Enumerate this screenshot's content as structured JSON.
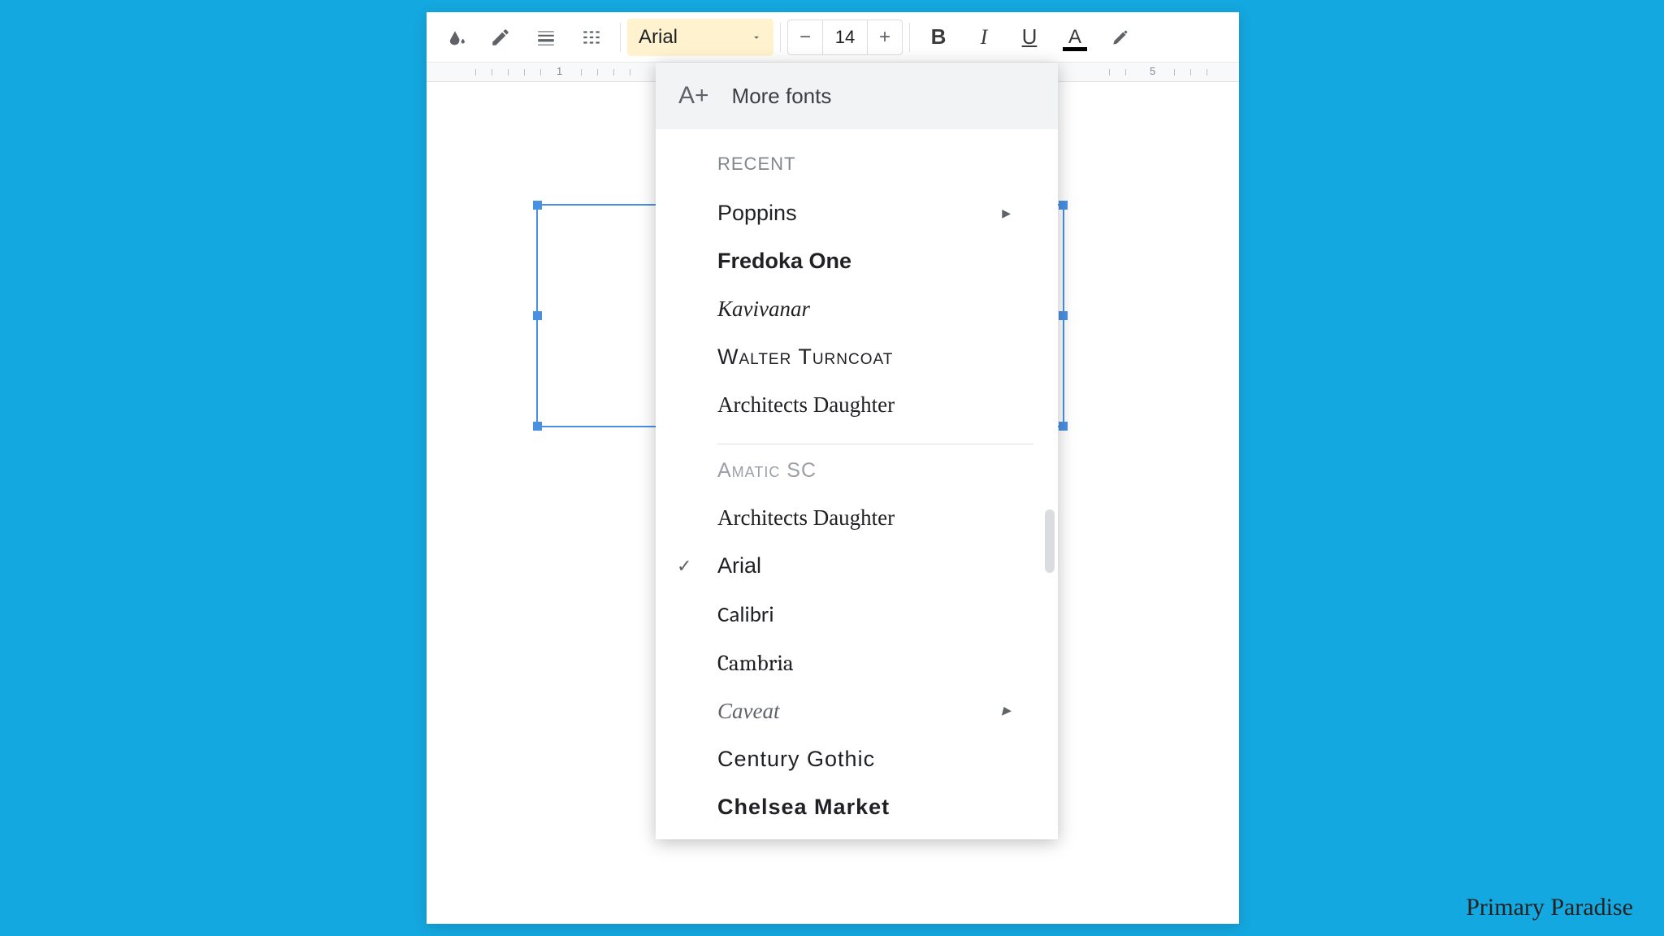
{
  "toolbar": {
    "font_name": "Arial",
    "font_size": "14"
  },
  "ruler": {
    "marks": [
      "1",
      "5"
    ]
  },
  "dropdown": {
    "more_fonts": "More fonts",
    "recent_heading": "RECENT",
    "recent": [
      {
        "label": "Poppins",
        "class": "f-poppins",
        "arrow": true
      },
      {
        "label": "Fredoka One",
        "class": "f-fredoka"
      },
      {
        "label": "Kavivanar",
        "class": "f-kavivanar"
      },
      {
        "label": "Walter Turncoat",
        "class": "f-walter"
      },
      {
        "label": "Architects Daughter",
        "class": "f-architects"
      }
    ],
    "all": [
      {
        "label": "Amatic SC",
        "class": "f-amatic"
      },
      {
        "label": "Architects Daughter",
        "class": "f-architects"
      },
      {
        "label": "Arial",
        "class": "f-arial",
        "checked": true
      },
      {
        "label": "Calibri",
        "class": "f-calibri"
      },
      {
        "label": "Cambria",
        "class": "f-cambria"
      },
      {
        "label": "Caveat",
        "class": "f-caveat",
        "arrow": true
      },
      {
        "label": "Century Gothic",
        "class": "f-century"
      },
      {
        "label": "Chelsea Market",
        "class": "f-chelsea"
      }
    ]
  },
  "watermark": "Primary Paradise"
}
